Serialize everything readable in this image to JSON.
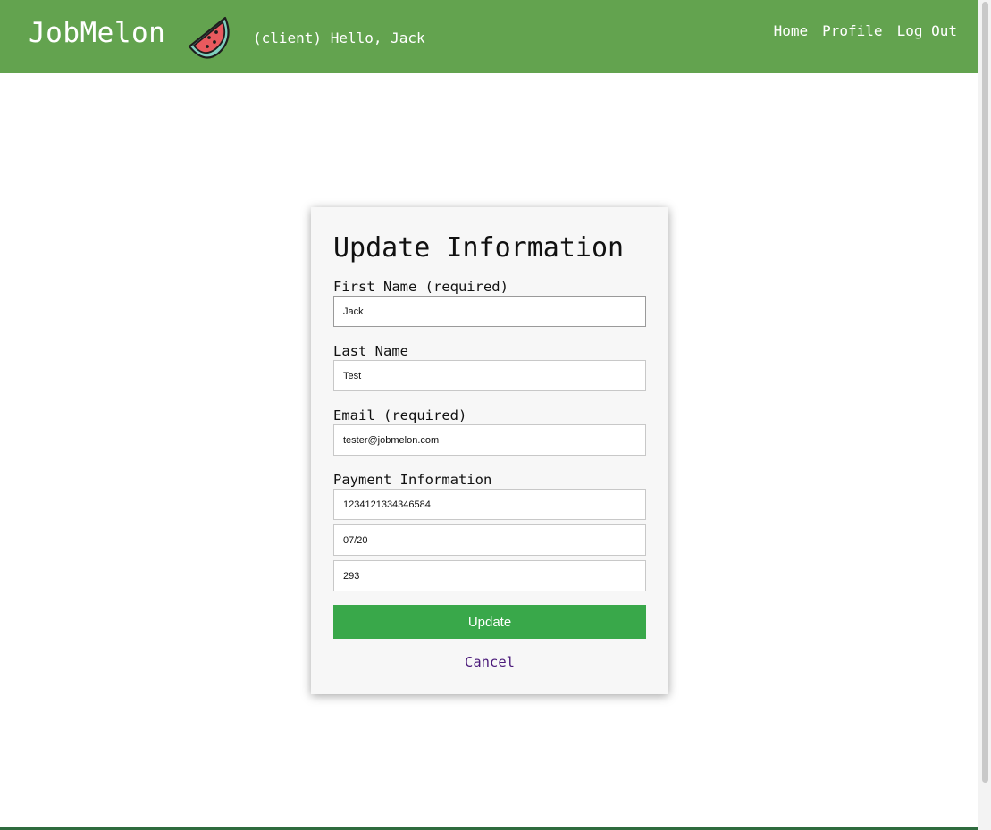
{
  "header": {
    "brand": "JobMelon",
    "greeting": "(client) Hello, Jack",
    "nav": [
      "Home",
      "Profile",
      "Log Out"
    ]
  },
  "form": {
    "title": "Update Information",
    "first_name_label": "First Name (required)",
    "first_name_value": "Jack",
    "last_name_label": "Last Name",
    "last_name_value": "Test",
    "email_label": "Email (required)",
    "email_value": "tester@jobmelon.com",
    "payment_label": "Payment Information",
    "card_number_value": "1234121334346584",
    "expiry_value": "07/20",
    "cvv_value": "293",
    "update_label": "Update",
    "cancel_label": "Cancel"
  },
  "colors": {
    "header_bg": "#63a34f",
    "button_bg": "#39a84a",
    "cancel_link": "#4b1a7a"
  },
  "icons": {
    "logo": "watermelon-icon"
  }
}
